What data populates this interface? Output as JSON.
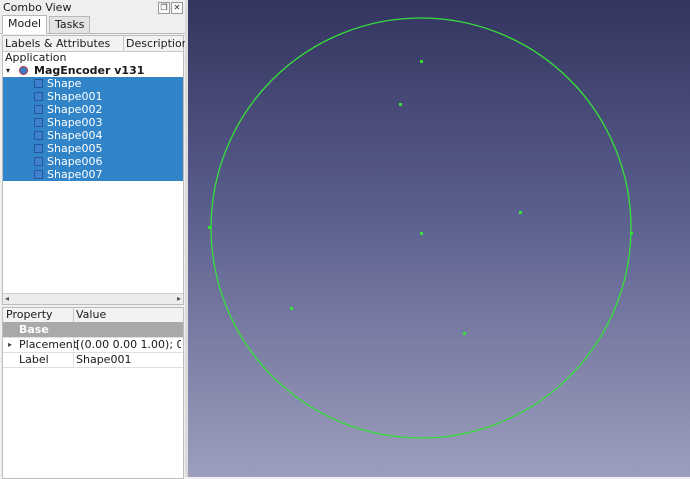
{
  "panel": {
    "title": "Combo View",
    "tabs": [
      "Model",
      "Tasks"
    ],
    "tree": {
      "columns": [
        "Labels & Attributes",
        "Description"
      ],
      "root": "Application",
      "document": "MagEncoder v131",
      "items": [
        "Shape",
        "Shape001",
        "Shape002",
        "Shape003",
        "Shape004",
        "Shape005",
        "Shape006",
        "Shape007"
      ]
    },
    "properties": {
      "columns": [
        "Property",
        "Value"
      ],
      "group": "Base",
      "rows": [
        {
          "name": "Placement",
          "value": "[(0.00 0.00 1.00); 0...."
        },
        {
          "name": "Label",
          "value": "Shape001"
        }
      ]
    }
  },
  "viewport": {
    "geometry_color": "#36e03a"
  }
}
